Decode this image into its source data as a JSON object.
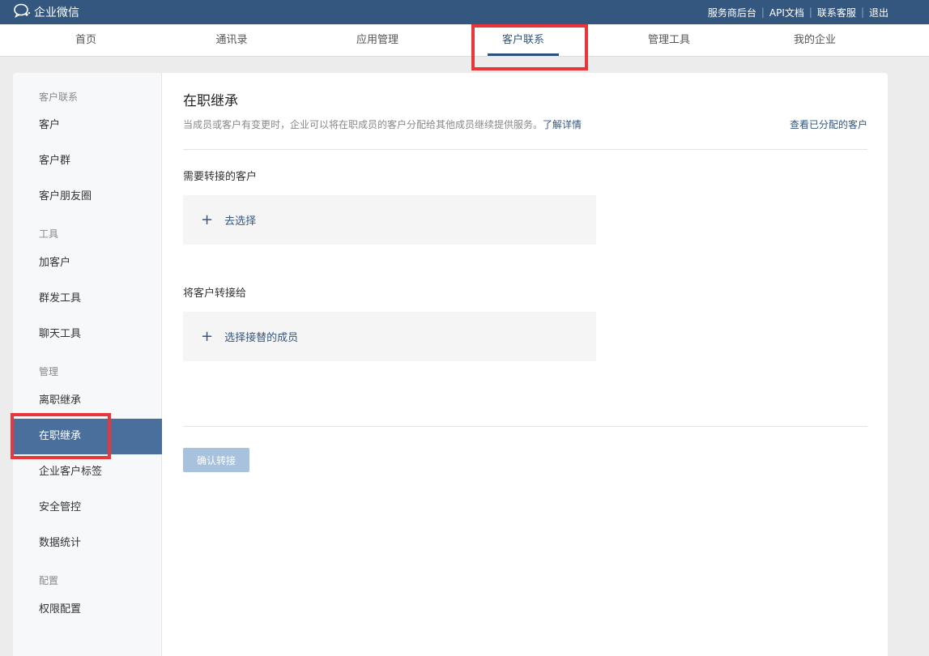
{
  "topbar": {
    "brand": "企业微信",
    "links": [
      "服务商后台",
      "API文档",
      "联系客服",
      "退出"
    ]
  },
  "nav": {
    "tabs": [
      "首页",
      "通讯录",
      "应用管理",
      "客户联系",
      "管理工具",
      "我的企业"
    ],
    "active": "客户联系"
  },
  "sidebar": {
    "groups": [
      {
        "heading": "客户联系",
        "items": [
          "客户",
          "客户群",
          "客户朋友圈"
        ]
      },
      {
        "heading": "工具",
        "items": [
          "加客户",
          "群发工具",
          "聊天工具"
        ]
      },
      {
        "heading": "管理",
        "items": [
          "离职继承",
          "在职继承",
          "企业客户标签",
          "安全管控",
          "数据统计"
        ]
      },
      {
        "heading": "配置",
        "items": [
          "权限配置"
        ]
      }
    ],
    "active": "在职继承"
  },
  "main": {
    "title": "在职继承",
    "description": "当成员或客户有变更时，企业可以将在职成员的客户分配给其他成员继续提供服务。",
    "learn_more": "了解详情",
    "view_assigned": "查看已分配的客户",
    "section1": {
      "label": "需要转接的客户",
      "action": "去选择"
    },
    "section2": {
      "label": "将客户转接给",
      "action": "选择接替的成员"
    },
    "confirm_label": "确认转接"
  },
  "colors": {
    "topbar": "#34577f",
    "accent": "#34577f",
    "sidebar_active": "#4a6f9c",
    "highlight": "#e8363a",
    "button_disabled": "#a8c2de"
  }
}
